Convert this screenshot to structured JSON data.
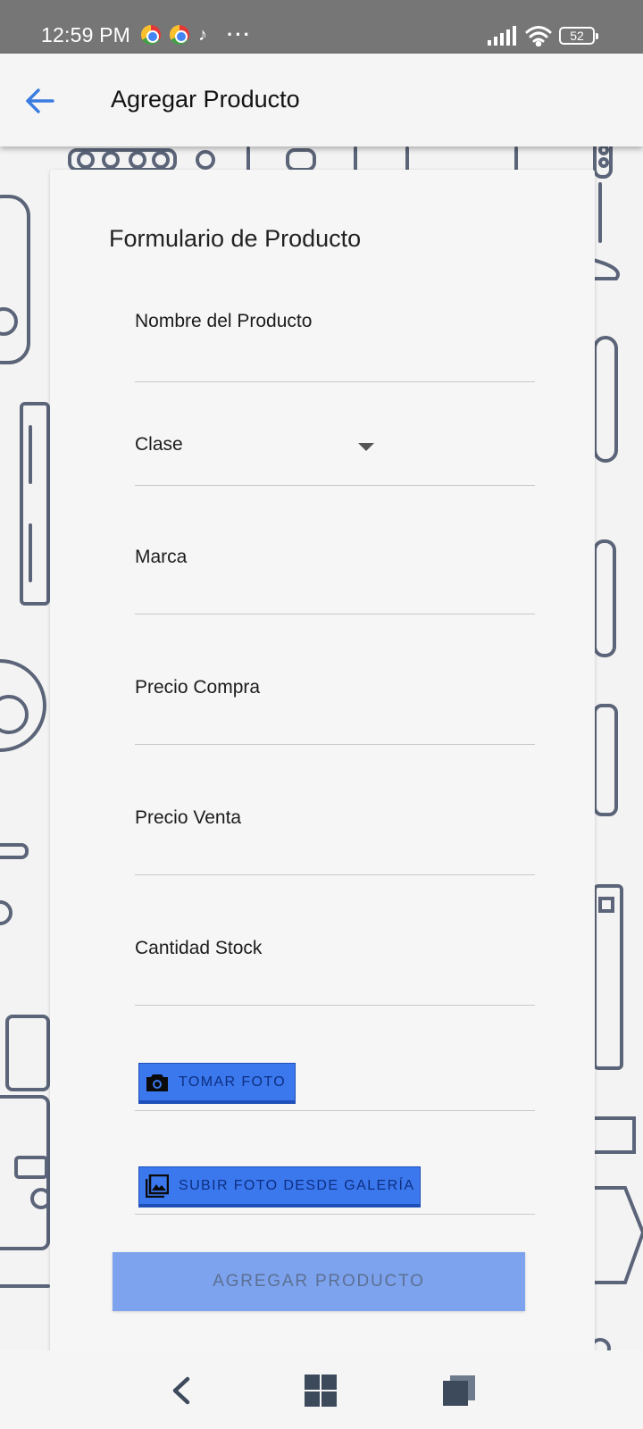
{
  "status_bar": {
    "time": "12:59 PM",
    "app_icons": [
      "chrome-icon",
      "chrome-icon",
      "tiktok-icon"
    ],
    "more": "···",
    "battery": "52"
  },
  "app_bar": {
    "title": "Agregar Producto",
    "back_icon": "arrow-left-icon"
  },
  "form": {
    "title": "Formulario de Producto",
    "fields": {
      "nombre": "Nombre del Producto",
      "clase": "Clase",
      "marca": "Marca",
      "precio_compra": "Precio Compra",
      "precio_venta": "Precio Venta",
      "cantidad_stock": "Cantidad Stock"
    },
    "buttons": {
      "tomar_foto": "TOMAR FOTO",
      "subir_foto": "SUBIR FOTO DESDE GALERÍA",
      "agregar": "AGREGAR PRODUCTO"
    }
  },
  "colors": {
    "accent": "#3b78ee",
    "submit_disabled": "#7ea3ee",
    "back_arrow": "#3a7be0",
    "status_bar": "#767676"
  },
  "nav_bar": {
    "icons": [
      "back-nav-icon",
      "home-nav-icon",
      "recents-nav-icon"
    ]
  }
}
